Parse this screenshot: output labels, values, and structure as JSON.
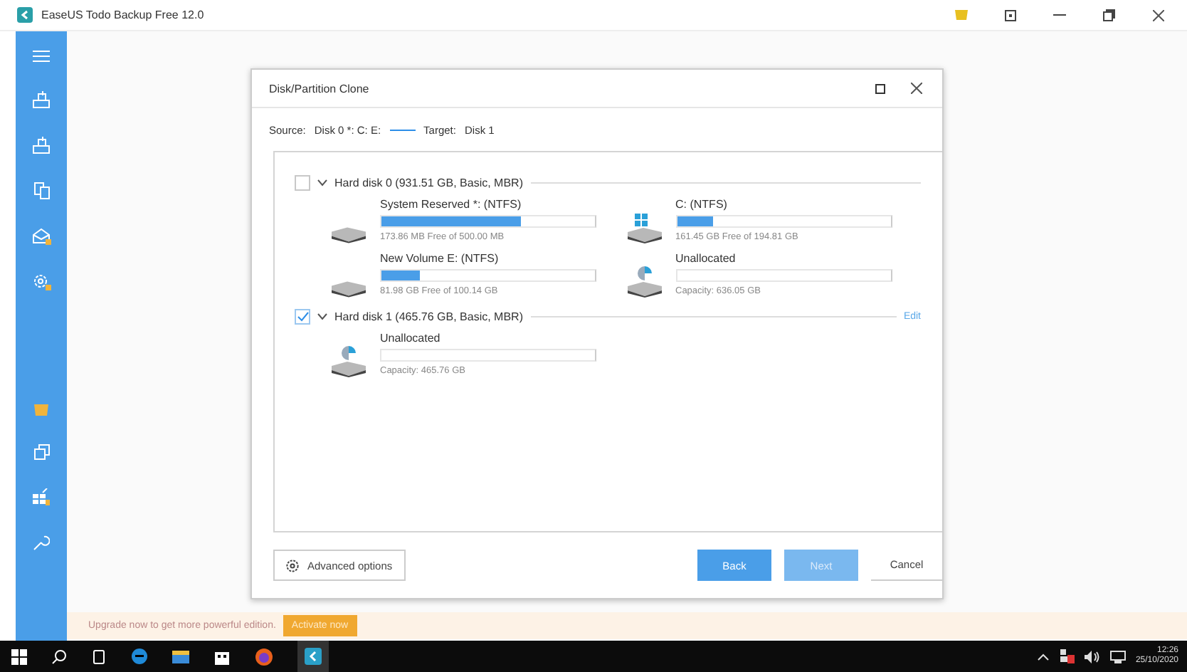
{
  "window": {
    "title": "EaseUS Todo Backup Free 12.0"
  },
  "dialog": {
    "title": "Disk/Partition Clone",
    "source_label": "Source:",
    "source_value": "Disk 0 *: C: E:",
    "target_label": "Target:",
    "target_value": "Disk 1",
    "disks": [
      {
        "name": "Hard disk 0 (931.51 GB, Basic, MBR)",
        "checked": false,
        "expanded": true,
        "partitions": [
          {
            "kind": "drive",
            "name": "System Reserved *: (NTFS)",
            "level": 0.65,
            "info": "173.86 MB Free of 500.00 MB"
          },
          {
            "kind": "system_drive",
            "name": "C: (NTFS)",
            "level": 0.17,
            "info": "161.45 GB Free of 194.81 GB"
          },
          {
            "kind": "drive",
            "name": "New Volume E: (NTFS)",
            "level": 0.18,
            "info": "81.98 GB Free of 100.14 GB"
          },
          {
            "kind": "unallocated",
            "name": "Unallocated",
            "info": "Capacity: 636.05 GB"
          }
        ]
      },
      {
        "name": "Hard disk 1 (465.76 GB, Basic, MBR)",
        "checked": true,
        "expanded": true,
        "edit": "Edit",
        "partitions": [
          {
            "kind": "unallocated",
            "name": "Unallocated",
            "info": "Capacity: 465.76 GB"
          }
        ]
      }
    ],
    "advanced": "Advanced options",
    "buttons": [
      {
        "kind": "primary",
        "label": "Back",
        "disabled": false
      },
      {
        "kind": "primary",
        "label": "Next",
        "disabled": true
      },
      {
        "kind": "plain",
        "label": "Cancel",
        "disabled": false
      }
    ]
  },
  "banner": {
    "text": "Upgrade now to get more powerful edition.",
    "button": "Activate now"
  },
  "taskbar": {
    "time": "12:26",
    "date": "25/10/2020"
  }
}
